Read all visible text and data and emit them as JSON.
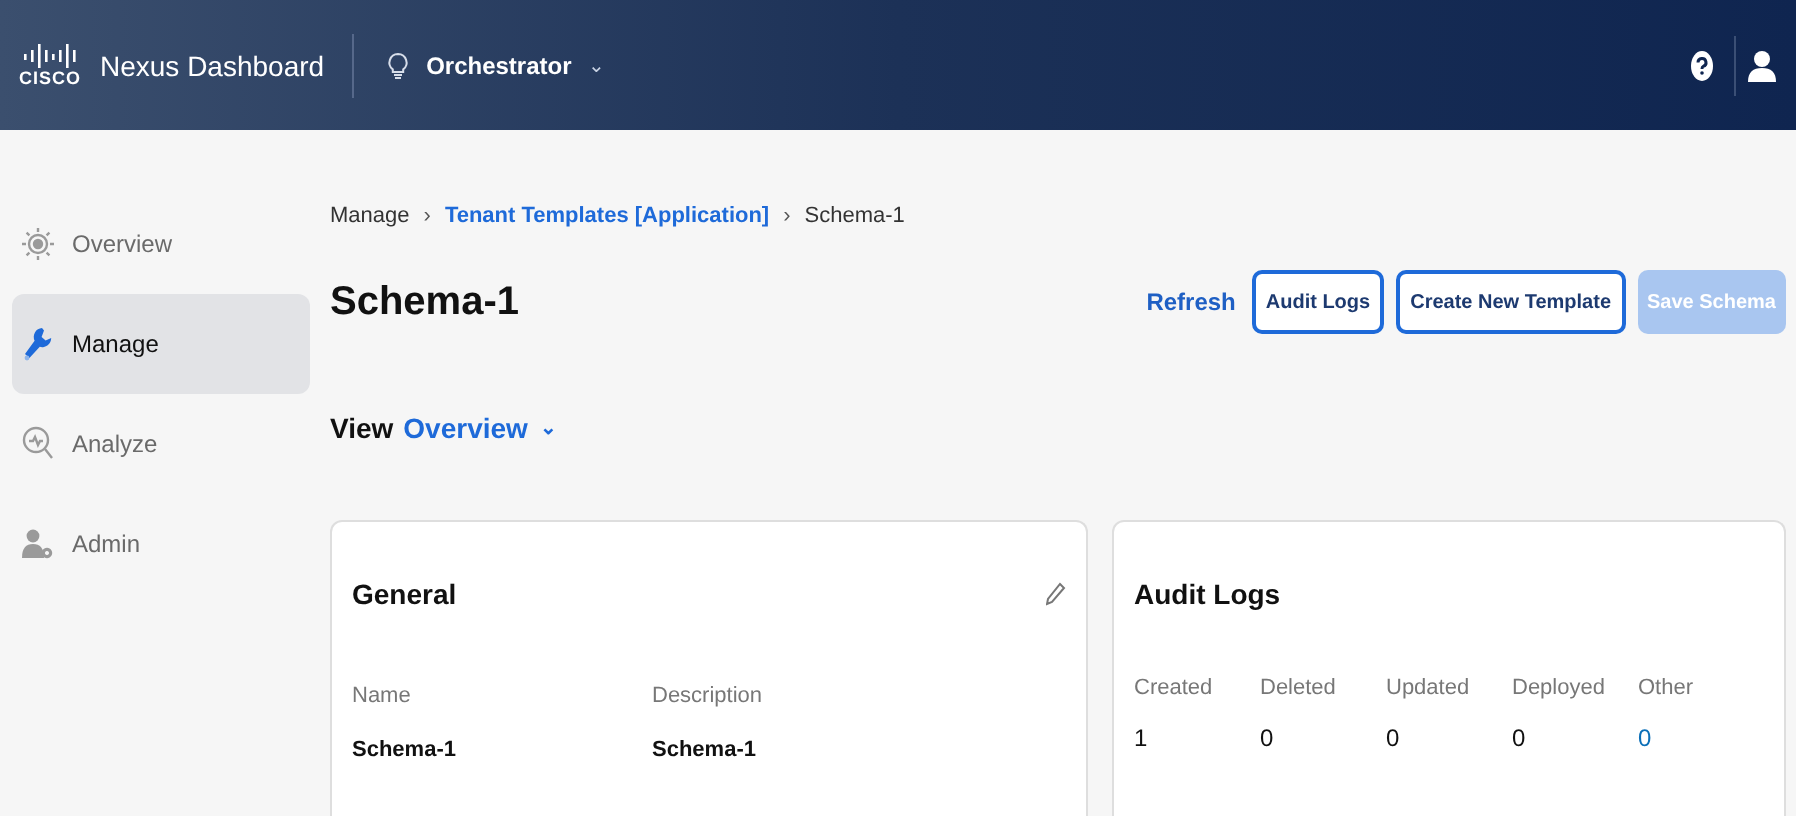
{
  "header": {
    "logo_text": "CISCO",
    "app_title": "Nexus Dashboard",
    "service": {
      "label": "Orchestrator",
      "caret": "⌄"
    }
  },
  "sidebar": {
    "items": [
      {
        "label": "Overview",
        "selected": false
      },
      {
        "label": "Manage",
        "selected": true
      },
      {
        "label": "Analyze",
        "selected": false
      },
      {
        "label": "Admin",
        "selected": false
      }
    ]
  },
  "breadcrumb": [
    {
      "label": "Manage",
      "link": false
    },
    {
      "label": "Tenant Templates [Application]",
      "link": true
    },
    {
      "label": "Schema-1",
      "link": false
    }
  ],
  "breadcrumb_separator": "›",
  "title": "Schema-1",
  "actions": [
    {
      "label": "Refresh",
      "kind": "link",
      "disabled": false
    },
    {
      "label": "Audit Logs",
      "kind": "outline",
      "disabled": false
    },
    {
      "label": "Create New Template",
      "kind": "outline",
      "disabled": false
    },
    {
      "label": "Save Schema",
      "kind": "primary",
      "disabled": true
    }
  ],
  "view": {
    "label": "View",
    "value": "Overview",
    "caret": "⌄"
  },
  "general_card": {
    "title": "General",
    "fields": [
      {
        "label": "Name",
        "value": "Schema-1"
      },
      {
        "label": "Description",
        "value": "Schema-1"
      }
    ]
  },
  "audit_card": {
    "title": "Audit Logs",
    "stats": [
      {
        "label": "Created",
        "value": "1",
        "link": false
      },
      {
        "label": "Deleted",
        "value": "0",
        "link": false
      },
      {
        "label": "Updated",
        "value": "0",
        "link": false
      },
      {
        "label": "Deployed",
        "value": "0",
        "link": false
      },
      {
        "label": "Other",
        "value": "0",
        "link": true
      }
    ]
  }
}
